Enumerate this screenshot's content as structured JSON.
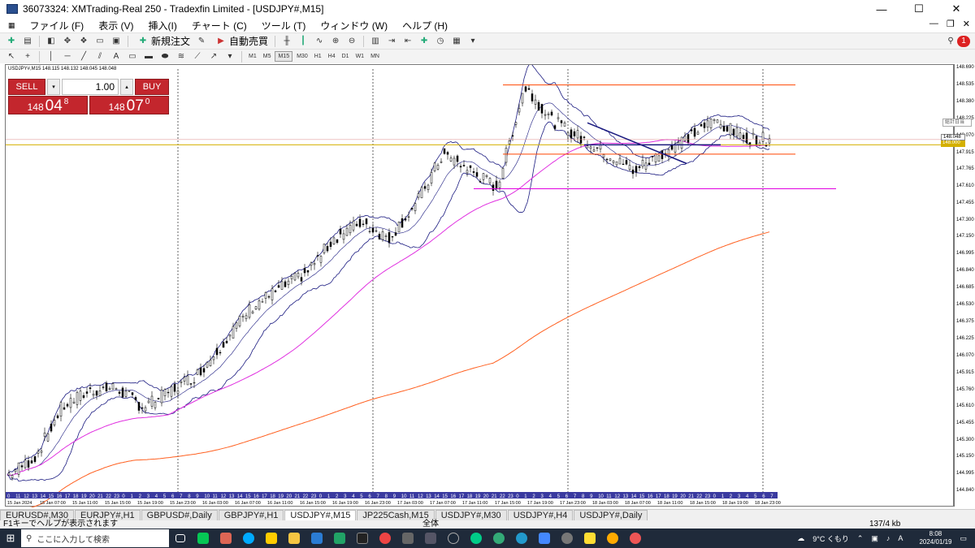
{
  "window": {
    "title": "36073324: XMTrading-Real 250 - Tradexfin Limited - [USDJPY#,M15]",
    "minimize": "—",
    "maximize": "☐",
    "close": "✕"
  },
  "menu": {
    "items": [
      "ファイル (F)",
      "表示 (V)",
      "挿入(I)",
      "チャート (C)",
      "ツール (T)",
      "ウィンドウ (W)",
      "ヘルプ (H)"
    ]
  },
  "toolbar": {
    "new_order": "新規注文",
    "auto_trading": "自動売買",
    "timeframes": [
      "M1",
      "M5",
      "M15",
      "M30",
      "H1",
      "H4",
      "D1",
      "W1",
      "MN"
    ],
    "active_timeframe": "M15"
  },
  "chart": {
    "symbol_line": "USDJPY#,M15  148.115 148.132 148.045 148.048",
    "one_click": {
      "sell_label": "SELL",
      "buy_label": "BUY",
      "lot": "1.00",
      "sell_price": {
        "big": "148",
        "main": "04",
        "small": "8"
      },
      "buy_price": {
        "big": "148",
        "main": "07",
        "small": "0"
      }
    },
    "price_labels": [
      "148.690",
      "148.535",
      "148.380",
      "148.225",
      "148.070",
      "147.915",
      "147.765",
      "147.610",
      "147.455",
      "147.300",
      "147.150",
      "146.995",
      "146.840",
      "146.685",
      "146.530",
      "146.375",
      "146.225",
      "146.070",
      "145.915",
      "145.760",
      "145.610",
      "145.455",
      "145.300",
      "145.150",
      "144.995",
      "144.840"
    ],
    "current_bid": "148.048",
    "current_level": "148.000",
    "position_label": "総計日当",
    "time_labels": [
      "15 Jan 2024",
      "15 Jan 07:00",
      "15 Jan 11:00",
      "15 Jan 15:00",
      "15 Jan 19:00",
      "15 Jan 23:00",
      "16 Jan 03:00",
      "16 Jan 07:00",
      "16 Jan 11:00",
      "16 Jan 15:00",
      "16 Jan 19:00",
      "16 Jan 23:00",
      "17 Jan 03:00",
      "17 Jan 07:00",
      "17 Jan 11:00",
      "17 Jan 15:00",
      "17 Jan 19:00",
      "17 Jan 23:00",
      "18 Jan 03:00",
      "18 Jan 07:00",
      "18 Jan 11:00",
      "18 Jan 15:00",
      "18 Jan 19:00",
      "18 Jan 23:00"
    ],
    "hour_strip": "0 11 12 13 14 15 16 17 18 19 20 21 22 23 0 1 2 3 4 5 6 7 8 9 10 11 12 13 14 15 16 17 18 19 20 21 22 23 0 1 2 3 4 5 6 7 8 9 10 11 12 13 14 15 16 17 18 19 20 21 22 23 0 1 2 3 4 5 6 7 8 9 10 11 12 13 14 15 16 17 18 19 20 21 22 23 0 1 2 3 4 5 6 7 8"
  },
  "chart_data": {
    "type": "candlestick",
    "symbol": "USDJPY#",
    "timeframe": "M15",
    "ylim": [
      144.84,
      148.69
    ],
    "x_range": [
      "15 Jan 2024",
      "18 Jan 23:00"
    ],
    "ohlc": [
      144.995,
      145.15,
      145.61,
      145.76,
      145.79,
      145.61,
      145.76,
      145.915,
      146.225,
      146.53,
      146.685,
      146.84,
      147.15,
      147.3,
      147.15,
      147.455,
      147.915,
      147.765,
      147.61,
      148.535,
      148.225,
      148.07,
      147.915,
      147.765,
      147.915,
      148.07,
      148.225,
      148.07,
      148.048
    ]
  },
  "tabs": [
    "EURUSD#,M30",
    "EURJPY#,H1",
    "GBPUSD#,Daily",
    "GBPJPY#,H1",
    "USDJPY#,M15",
    "JP225Cash,M15",
    "USDJPY#,M30",
    "USDJPY#,H4",
    "USDJPY#,Daily"
  ],
  "active_tab": "USDJPY#,M15",
  "status": {
    "help": "F1キーでヘルプが表示されます",
    "profile": "全体",
    "traffic": "137/4 kb"
  },
  "taskbar": {
    "search_placeholder": "ここに入力して検索",
    "weather": "9°C くもり",
    "ime": "A",
    "time": "8:08",
    "date": "2024/01/19"
  },
  "colors": {
    "sell_buy_red": "#c3262d",
    "bb_band": "#1a1a80",
    "ma_pink": "#e030e0",
    "ma_orange": "#ff6020",
    "resistance_orange": "#ff4500",
    "support_magenta": "#e000e0",
    "level_gold": "#d4b000"
  }
}
